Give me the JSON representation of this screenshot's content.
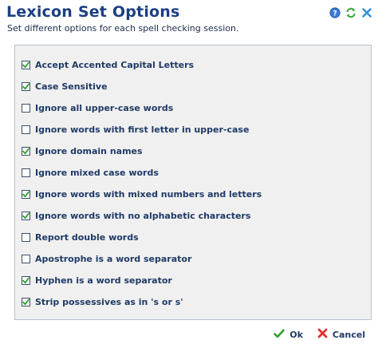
{
  "dialog": {
    "title": "Lexicon Set Options",
    "subtitle": "Set different options for each spell checking session."
  },
  "header_icons": [
    "help-icon",
    "refresh-icon",
    "close-icon"
  ],
  "options": [
    {
      "label": "Accept Accented Capital Letters",
      "checked": true
    },
    {
      "label": "Case Sensitive",
      "checked": true
    },
    {
      "label": "Ignore all upper-case words",
      "checked": false
    },
    {
      "label": "Ignore words with first letter in upper-case",
      "checked": false
    },
    {
      "label": "Ignore domain names",
      "checked": true
    },
    {
      "label": "Ignore mixed case words",
      "checked": false
    },
    {
      "label": "Ignore words with mixed numbers and letters",
      "checked": true
    },
    {
      "label": "Ignore words with no alphabetic characters",
      "checked": true
    },
    {
      "label": "Report double words",
      "checked": false
    },
    {
      "label": "Apostrophe is a word separator",
      "checked": false
    },
    {
      "label": "Hyphen is a word separator",
      "checked": true
    },
    {
      "label": "Strip possessives as in 's or s'",
      "checked": true
    }
  ],
  "footer": {
    "ok_label": "Ok",
    "cancel_label": "Cancel"
  },
  "colors": {
    "title": "#1c3f82",
    "panel_bg": "#f0f0f0",
    "check": "#2f9e2f",
    "cancel": "#e03030"
  }
}
